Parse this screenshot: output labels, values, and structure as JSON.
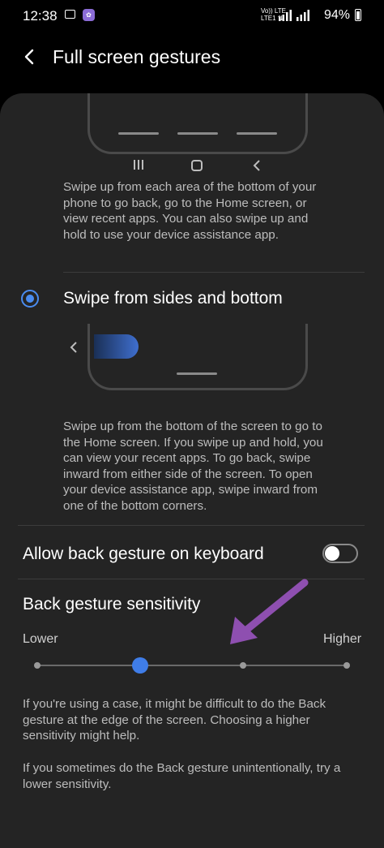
{
  "status_bar": {
    "time": "12:38",
    "lte_top": "Vo)) LTE",
    "lte_bottom": "LTE1 ⇅",
    "battery": "94%"
  },
  "header": {
    "title": "Full screen gestures"
  },
  "buttons_option": {
    "description": "Swipe up from each area of the bottom of your phone to go back, go to the Home screen, or view recent apps. You can also swipe up and hold to use your device assistance app."
  },
  "sides_option": {
    "label": "Swipe from sides and bottom",
    "selected": true,
    "description": "Swipe up from the bottom of the screen to go to the Home screen. If you swipe up and hold, you can view your recent apps. To go back, swipe inward from either side of the screen. To open your device assistance app, swipe inward from one of the bottom corners."
  },
  "keyboard_back": {
    "label": "Allow back gesture on keyboard",
    "enabled": false
  },
  "sensitivity": {
    "title": "Back gesture sensitivity",
    "lower_label": "Lower",
    "higher_label": "Higher",
    "level": 2,
    "levels": 4,
    "note1": "If you're using a case, it might be difficult to do the Back gesture at the edge of the screen. Choosing a higher sensitivity might help.",
    "note2": "If you sometimes do the Back gesture unintentionally, try a lower sensitivity."
  },
  "colors": {
    "accent": "#3f7de8",
    "annotation_arrow": "#8e4fb0",
    "card_background": "#242424"
  }
}
